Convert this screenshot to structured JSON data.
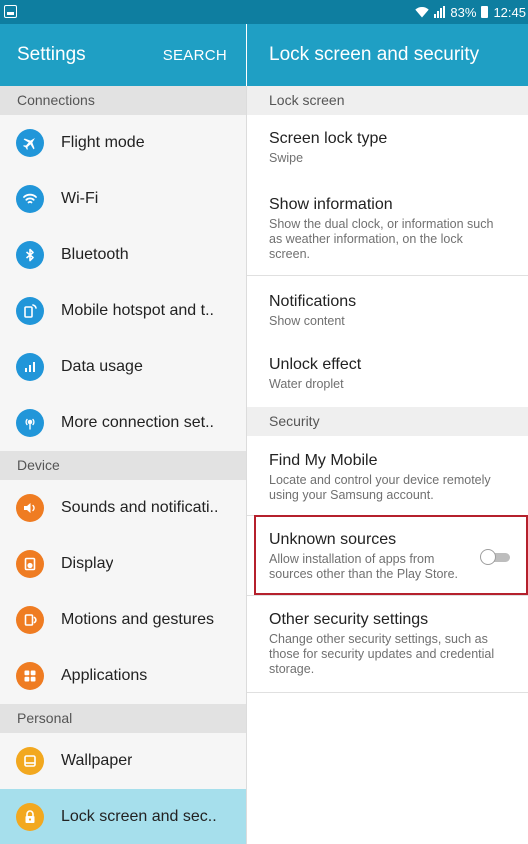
{
  "status_bar": {
    "battery": "83%",
    "time": "12:45",
    "icons": [
      "notification-icon",
      "wifi-icon",
      "signal-icon",
      "battery-icon"
    ]
  },
  "left": {
    "title": "Settings",
    "search_label": "SEARCH",
    "sections": [
      {
        "header": "Connections",
        "items": [
          {
            "label": "Flight mode",
            "icon": "airplane-icon",
            "color": "#2196d9"
          },
          {
            "label": "Wi-Fi",
            "icon": "wifi-icon",
            "color": "#2196d9"
          },
          {
            "label": "Bluetooth",
            "icon": "bluetooth-icon",
            "color": "#2196d9"
          },
          {
            "label": "Mobile hotspot and t..",
            "icon": "hotspot-icon",
            "color": "#2196d9"
          },
          {
            "label": "Data usage",
            "icon": "data-usage-icon",
            "color": "#2196d9"
          },
          {
            "label": "More connection set..",
            "icon": "more-connections-icon",
            "color": "#2196d9"
          }
        ]
      },
      {
        "header": "Device",
        "items": [
          {
            "label": "Sounds and notificati..",
            "icon": "sound-icon",
            "color": "#ef7c22"
          },
          {
            "label": "Display",
            "icon": "display-icon",
            "color": "#ef7c22"
          },
          {
            "label": "Motions and gestures",
            "icon": "motion-icon",
            "color": "#ef7c22"
          },
          {
            "label": "Applications",
            "icon": "apps-icon",
            "color": "#ef7c22"
          }
        ]
      },
      {
        "header": "Personal",
        "items": [
          {
            "label": "Wallpaper",
            "icon": "wallpaper-icon",
            "color": "#f2a81f"
          },
          {
            "label": "Lock screen and sec..",
            "icon": "lock-icon",
            "color": "#f2a81f",
            "selected": true
          }
        ]
      }
    ]
  },
  "right": {
    "title": "Lock screen and security",
    "sections": [
      {
        "header": "Lock screen",
        "items": [
          {
            "title": "Screen lock type",
            "subtitle": "Swipe"
          },
          {
            "title": "Show information",
            "subtitle": "Show the dual clock, or information such as weather information, on the lock screen."
          },
          {
            "title": "Notifications",
            "subtitle": "Show content"
          },
          {
            "title": "Unlock effect",
            "subtitle": "Water droplet"
          }
        ]
      },
      {
        "header": "Security",
        "items": [
          {
            "title": "Find My Mobile",
            "subtitle": "Locate and control your device remotely using your Samsung account."
          },
          {
            "title": "Unknown sources",
            "subtitle": "Allow installation of apps from sources other than the Play Store.",
            "toggle": false,
            "highlighted": true
          },
          {
            "title": "Other security settings",
            "subtitle": "Change other security settings, such as those for security updates and credential storage."
          }
        ]
      }
    ]
  },
  "colors": {
    "header": "#1f9fc4",
    "status_bar": "#0e7ea0",
    "selected": "#a6dfec",
    "highlight": "#b5202c"
  }
}
